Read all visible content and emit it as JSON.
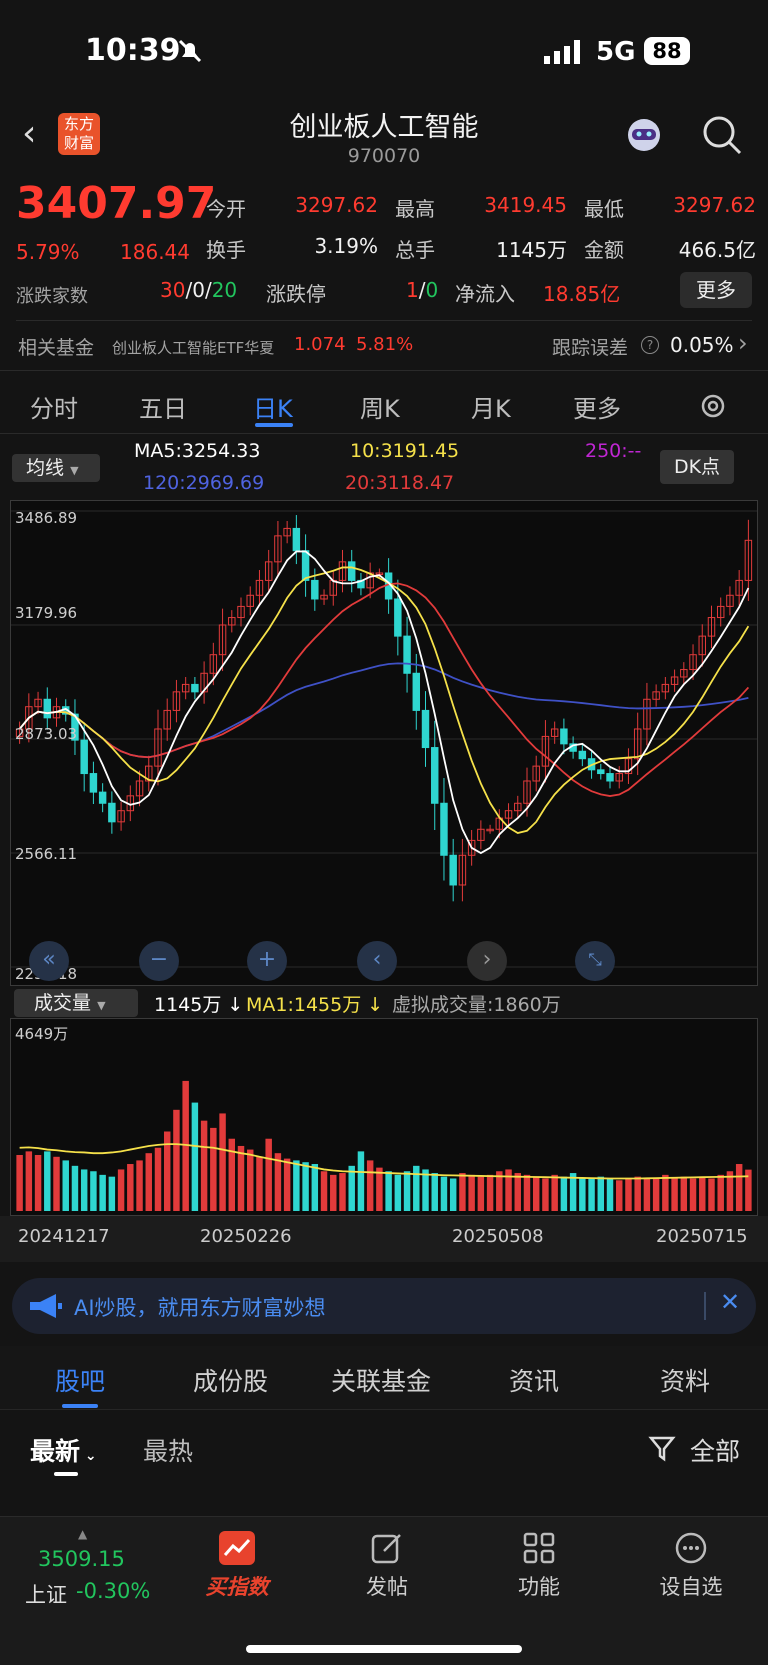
{
  "status_bar": {
    "time": "10:39",
    "network": "5G",
    "battery": "88"
  },
  "header": {
    "logo_text": "东方财富",
    "title": "创业板人工智能",
    "code": "970070"
  },
  "quote": {
    "price": "3407.97",
    "change_pct": "5.79%",
    "change": "186.44",
    "open_label": "今开",
    "open": "3297.62",
    "high_label": "最高",
    "high": "3419.45",
    "low_label": "最低",
    "low": "3297.62",
    "turnover_label": "换手",
    "turnover": "3.19%",
    "volume_label": "总手",
    "volume": "1145万",
    "amount_label": "金额",
    "amount": "466.5亿",
    "breadth_label": "涨跌家数",
    "breadth_up": "30",
    "breadth_flat": "0",
    "breadth_down": "20",
    "breadth_sep": "/",
    "limit_label": "涨跌停",
    "limit_up": "1",
    "limit_down": "0",
    "netflow_label": "净流入",
    "netflow": "18.85亿",
    "more_button": "更多",
    "fund_label": "相关基金",
    "fund_name": "创业板人工智能ETF华夏",
    "fund_price": "1.074",
    "fund_change": "5.81%",
    "tracking_label": "跟踪误差",
    "tracking_value": "0.05%"
  },
  "tabs": [
    "分时",
    "五日",
    "日K",
    "周K",
    "月K",
    "更多"
  ],
  "active_tab": "日K",
  "ma": {
    "selector": "均线",
    "ma5": "MA5:3254.33",
    "ma10": "10:3191.45",
    "ma250": "250:--",
    "ma120": "120:2969.69",
    "ma20": "20:3118.47",
    "dk_button": "DK点"
  },
  "price_axis": [
    "3486.89",
    "3179.96",
    "2873.03",
    "2566.11",
    "2259.18"
  ],
  "volume_panel": {
    "selector": "成交量",
    "vol": "1145万",
    "ma1": "MA1:1455万",
    "virtual": "虚拟成交量:1860万",
    "max_label": "4649万",
    "dates": [
      "20241217",
      "20250226",
      "20250508",
      "20250715"
    ]
  },
  "chart_data": {
    "type": "candlestick",
    "ylim": [
      2259.18,
      3486.89
    ],
    "ma_colors": {
      "ma5": "#ffffff",
      "ma10": "#f5e14a",
      "ma20": "#e23b3b",
      "ma120": "#3f51c6"
    },
    "close": [
      2900,
      2960,
      2980,
      2930,
      2960,
      2940,
      2870,
      2780,
      2730,
      2700,
      2650,
      2680,
      2720,
      2760,
      2800,
      2900,
      2950,
      3000,
      3020,
      3000,
      3050,
      3100,
      3180,
      3200,
      3230,
      3260,
      3300,
      3350,
      3420,
      3440,
      3380,
      3300,
      3250,
      3260,
      3300,
      3350,
      3300,
      3280,
      3320,
      3320,
      3250,
      3150,
      3050,
      2950,
      2850,
      2700,
      2560,
      2480,
      2560,
      2600,
      2630,
      2630,
      2660,
      2680,
      2700,
      2760,
      2800,
      2880,
      2900,
      2860,
      2840,
      2820,
      2790,
      2780,
      2760,
      2780,
      2820,
      2900,
      2980,
      3000,
      3020,
      3040,
      3060,
      3100,
      3150,
      3200,
      3230,
      3260,
      3300,
      3407.97
    ],
    "volume": [
      1550,
      1650,
      1550,
      1650,
      1500,
      1400,
      1250,
      1150,
      1100,
      1000,
      950,
      1150,
      1300,
      1400,
      1600,
      1750,
      2200,
      2800,
      3600,
      3000,
      2500,
      2300,
      2700,
      2000,
      1800,
      1700,
      1500,
      2000,
      1600,
      1450,
      1400,
      1350,
      1300,
      1100,
      1000,
      1050,
      1250,
      1650,
      1400,
      1200,
      1100,
      1000,
      1100,
      1250,
      1150,
      1050,
      950,
      900,
      1050,
      1000,
      950,
      1000,
      1100,
      1150,
      1050,
      1000,
      950,
      900,
      1000,
      950,
      1050,
      900,
      900,
      950,
      900,
      850,
      900,
      950,
      900,
      900,
      1000,
      900,
      950,
      900,
      950,
      900,
      1000,
      1100,
      1300,
      1145
    ],
    "volume_ma": [
      1750,
      1760,
      1740,
      1700,
      1680,
      1650,
      1630,
      1620,
      1600,
      1600,
      1620,
      1650,
      1700,
      1750,
      1800,
      1830,
      1850,
      1850,
      1830,
      1800,
      1770,
      1750,
      1700,
      1650,
      1600,
      1560,
      1500,
      1450,
      1400,
      1350,
      1300,
      1250,
      1200,
      1150,
      1120,
      1100,
      1090,
      1080,
      1070,
      1060,
      1050,
      1040,
      1030,
      1020,
      1010,
      1000,
      990,
      985,
      980,
      975,
      970,
      965,
      960,
      955,
      950,
      945,
      940,
      935,
      930,
      925,
      920,
      915,
      910,
      905,
      900,
      900,
      900,
      900,
      905,
      910,
      915,
      920,
      925,
      930,
      935,
      940,
      945,
      950,
      955,
      960
    ]
  },
  "ai_banner": {
    "text": "AI炒股，就用东方财富妙想"
  },
  "bottom_tabs": [
    "股吧",
    "成份股",
    "关联基金",
    "资讯",
    "资料"
  ],
  "sort": {
    "latest": "最新",
    "hot": "最热",
    "filter": "全部"
  },
  "bottom_nav": {
    "index_value": "3509.15",
    "index_name": "上证",
    "index_change": "-0.30%",
    "buy_index": "买指数",
    "post": "发帖",
    "func": "功能",
    "watch": "设自选"
  }
}
